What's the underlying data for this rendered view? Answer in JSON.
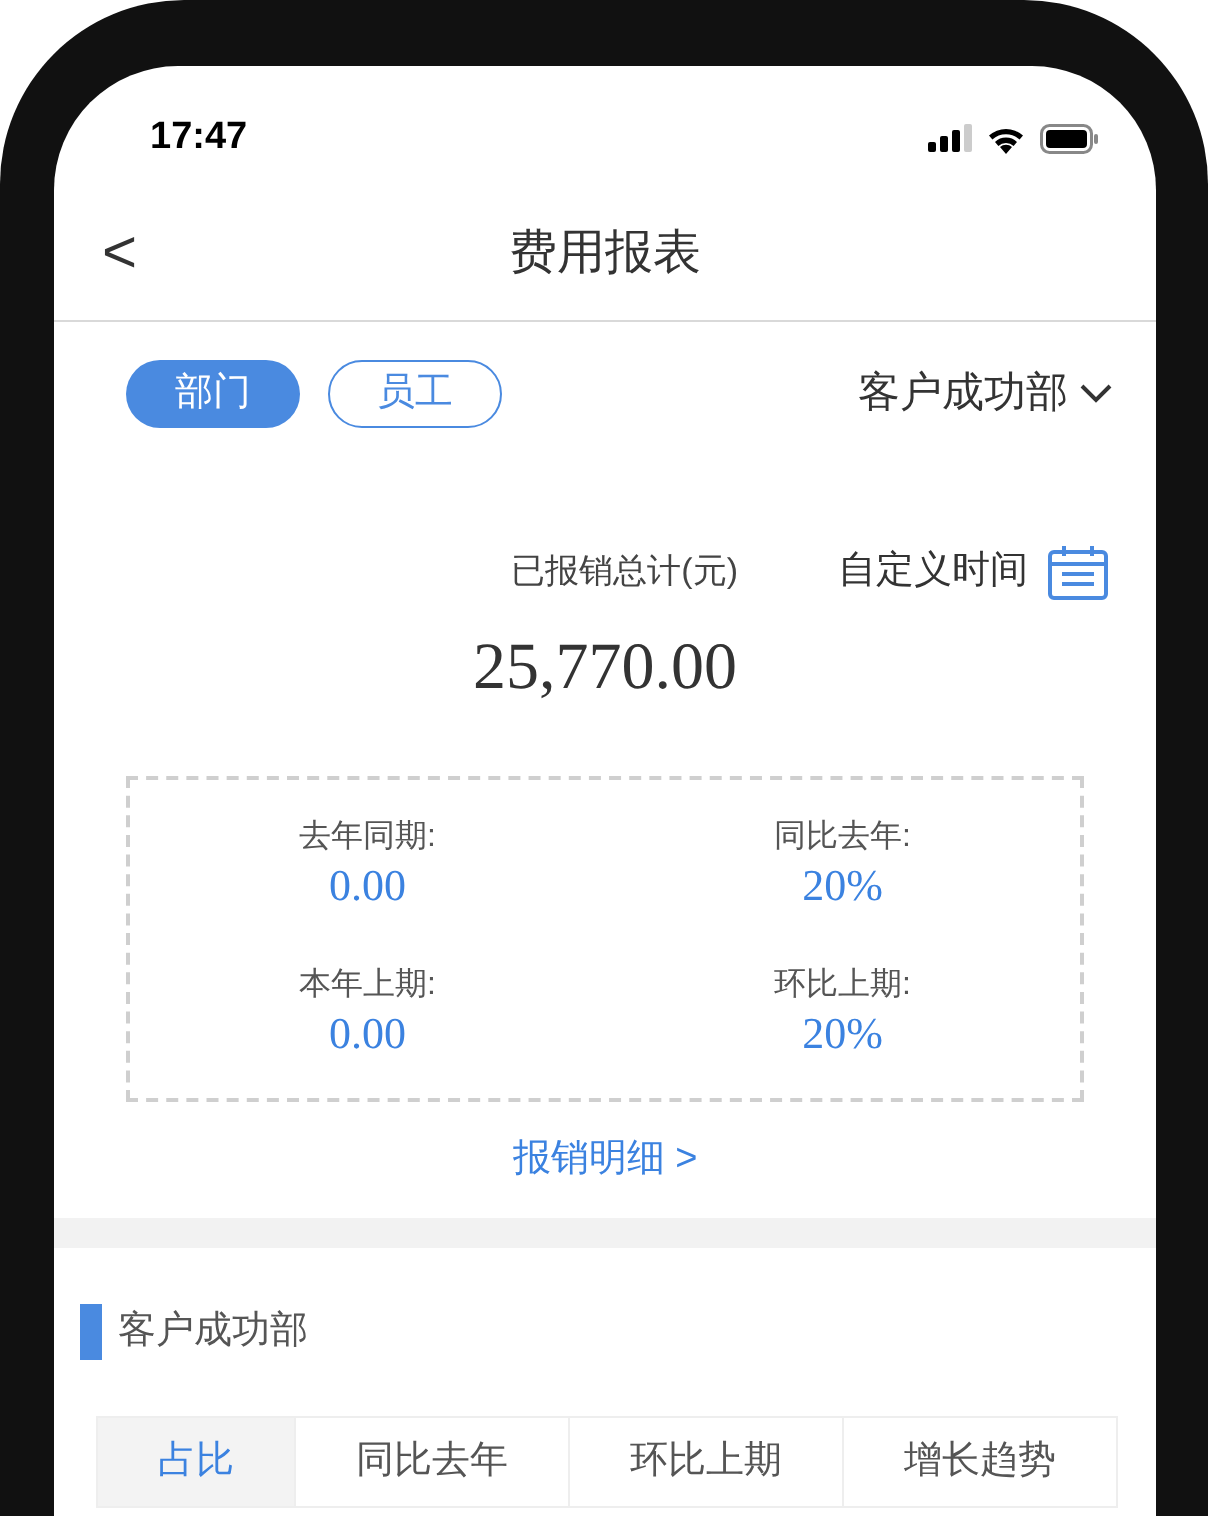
{
  "status_bar": {
    "time": "17:47"
  },
  "nav": {
    "back": "<",
    "title": "费用报表"
  },
  "filter": {
    "segments": [
      {
        "label": "部门",
        "selected": true
      },
      {
        "label": "员工",
        "selected": false
      }
    ],
    "department": "客户成功部"
  },
  "summary": {
    "label": "已报销总计(元)",
    "custom_time": "自定义时间",
    "total": "25,770.00",
    "stats": [
      {
        "label": "去年同期:",
        "value": "0.00"
      },
      {
        "label": "同比去年:",
        "value": "20%"
      },
      {
        "label": "本年上期:",
        "value": "0.00"
      },
      {
        "label": "环比上期:",
        "value": "20%"
      }
    ],
    "link": "报销明细 >"
  },
  "section": {
    "title": "客户成功部",
    "tabs": [
      {
        "label": "占比",
        "selected": true
      },
      {
        "label": "同比去年",
        "selected": false
      },
      {
        "label": "环比上期",
        "selected": false
      },
      {
        "label": "增长趋势",
        "selected": false
      }
    ]
  }
}
